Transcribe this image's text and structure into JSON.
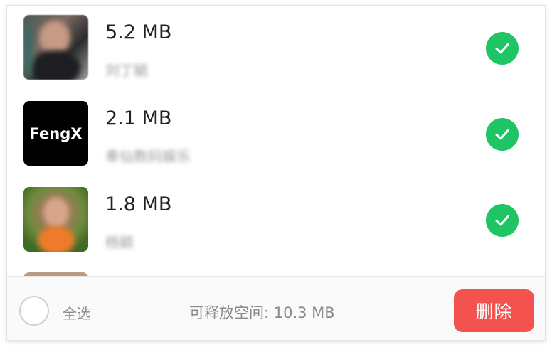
{
  "items": [
    {
      "size": "5.2 MB",
      "name": "刘丁毓",
      "checked": true,
      "thumb": "photo"
    },
    {
      "size": "2.1 MB",
      "name": "奉仙数码娱乐",
      "checked": true,
      "thumb": "logo",
      "logo_text": "FengX"
    },
    {
      "size": "1.8 MB",
      "name": "杨颖",
      "checked": true,
      "thumb": "photo"
    }
  ],
  "bottom_bar": {
    "select_all_label": "全选",
    "free_space_label": "可释放空间: 10.3 MB",
    "delete_label": "删除"
  },
  "colors": {
    "check_green": "#1fc464",
    "delete_red": "#f3524f"
  },
  "icons": {
    "check": "checkmark-icon",
    "select_all": "radio-circle-icon"
  }
}
